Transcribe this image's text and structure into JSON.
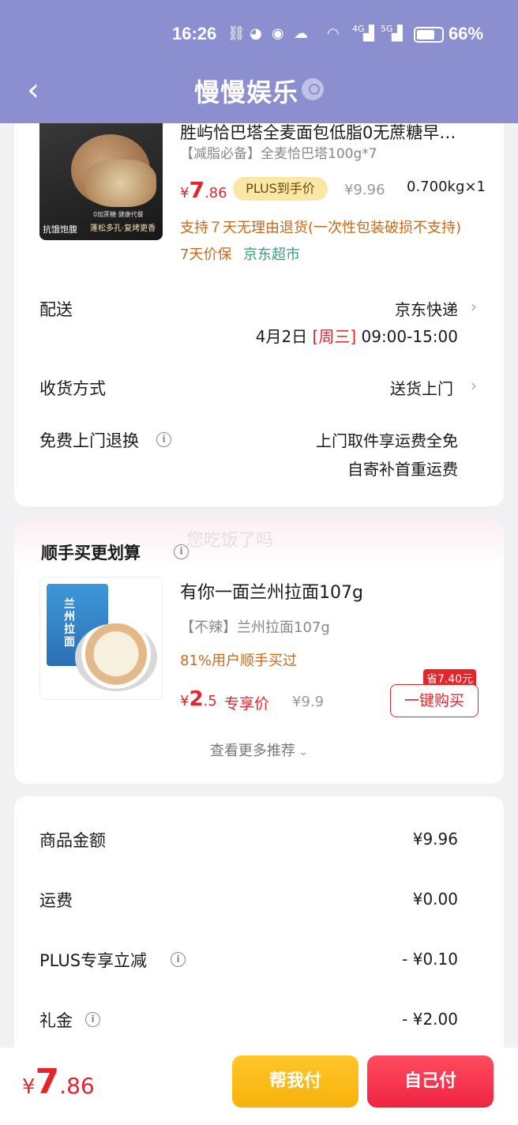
{
  "status_bar": {
    "time": "16:26",
    "battery_pct": "66%",
    "network_1": "4G",
    "network_2": "5G"
  },
  "nav": {
    "title": "慢慢娱乐"
  },
  "product": {
    "title": "胜屿恰巴塔全麦面包低脂0无蔗糖早…",
    "spec": "【减脂必备】全麦恰巴塔100g*7",
    "price_symbol": "¥",
    "price_int": "7",
    "price_dec": ".86",
    "plus_badge": "PLUS到手价",
    "orig_price": "¥9.96",
    "weight_qty": "0.700kg×1",
    "return_policy": "支持７天无理由退货(一次性包装破损不支持)",
    "price_protect": "7天价保",
    "store": "京东超市",
    "image_text_1": "抗饿饱腹",
    "image_text_2": "蓬松多孔·复烤更香",
    "image_text_3": "0加蔗糖 健康代餐"
  },
  "delivery": {
    "label": "配送",
    "carrier": "京东快递",
    "date_pre": "4月2日 ",
    "weekday": "[周三]",
    "time_slot": " 09:00-15:00"
  },
  "receive": {
    "label": "收货方式",
    "value": "送货上门"
  },
  "free_return": {
    "label": "免费上门退换",
    "line1": "上门取件享运费全免",
    "line2": "自寄补首重运费"
  },
  "upsell": {
    "title": "顺手买更划算",
    "watermark": "您吃饭了吗",
    "item_title": "有你一面兰州拉面107g",
    "item_spec": "【不辣】兰州拉面107g",
    "social": "81%用户顺手买过",
    "price_symbol": "¥",
    "price_int": "2",
    "price_dec": ".5",
    "price_label": "专享价",
    "orig_price": "¥9.9",
    "save_tag": "省7.40元",
    "buy_button": "一键购买",
    "more": "查看更多推荐",
    "pack_text": "兰州拉面"
  },
  "summary": {
    "rows": [
      {
        "label": "商品金额",
        "value": "¥9.96"
      },
      {
        "label": "运费",
        "value": "¥0.00"
      },
      {
        "label": "PLUS专享立减",
        "value": "- ¥0.10"
      },
      {
        "label": "礼金",
        "value": "- ¥2.00"
      }
    ]
  },
  "bottom": {
    "total_symbol": "¥",
    "total_int": "7",
    "total_dec": ".86",
    "help_pay": "帮我付",
    "self_pay": "自己付"
  },
  "colors": {
    "header": "#8b8fcf",
    "price_red": "#e4262b",
    "help_button": "#f6b20b",
    "self_button": "#ef2441"
  }
}
